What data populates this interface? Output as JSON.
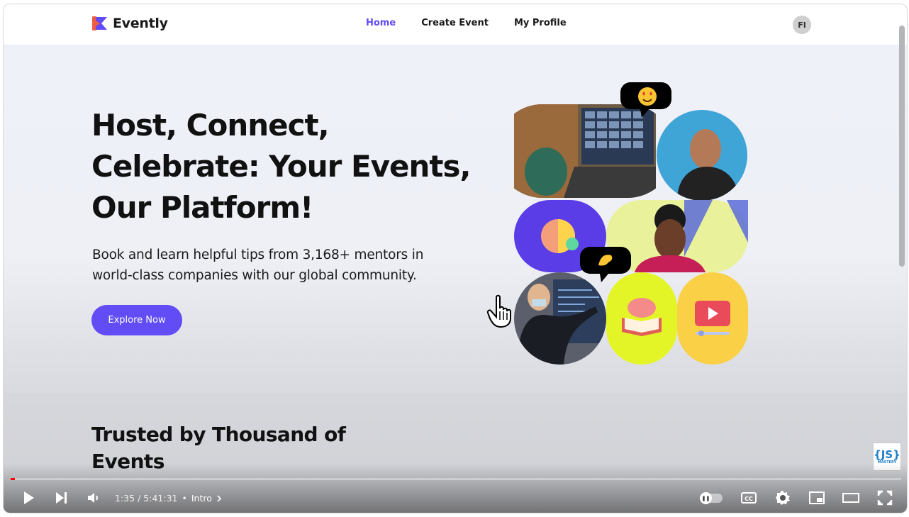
{
  "site": {
    "brand": "Evently",
    "nav": [
      {
        "label": "Home",
        "active": true
      },
      {
        "label": "Create Event",
        "active": false
      },
      {
        "label": "My Profile",
        "active": false
      }
    ],
    "avatar_initials": "FI"
  },
  "hero": {
    "title": "Host, Connect, Celebrate: Your Events, Our Platform!",
    "subtitle": "Book and learn helpful tips from 3,168+ mentors in world-class companies with our global community.",
    "cta": "Explore Now"
  },
  "trusted": {
    "title": "Trusted by Thousand of Events"
  },
  "badge": {
    "line1": "{JS}",
    "line2": "MASTERY"
  },
  "player": {
    "current_time": "1:35",
    "separator": "/",
    "duration": "5:41:31",
    "chapter_dot": "•",
    "chapter": "Intro",
    "progress_fraction": 0.0046,
    "autoplay": "paused"
  },
  "colors": {
    "accent": "#624cf5",
    "progress": "#ff0000"
  }
}
